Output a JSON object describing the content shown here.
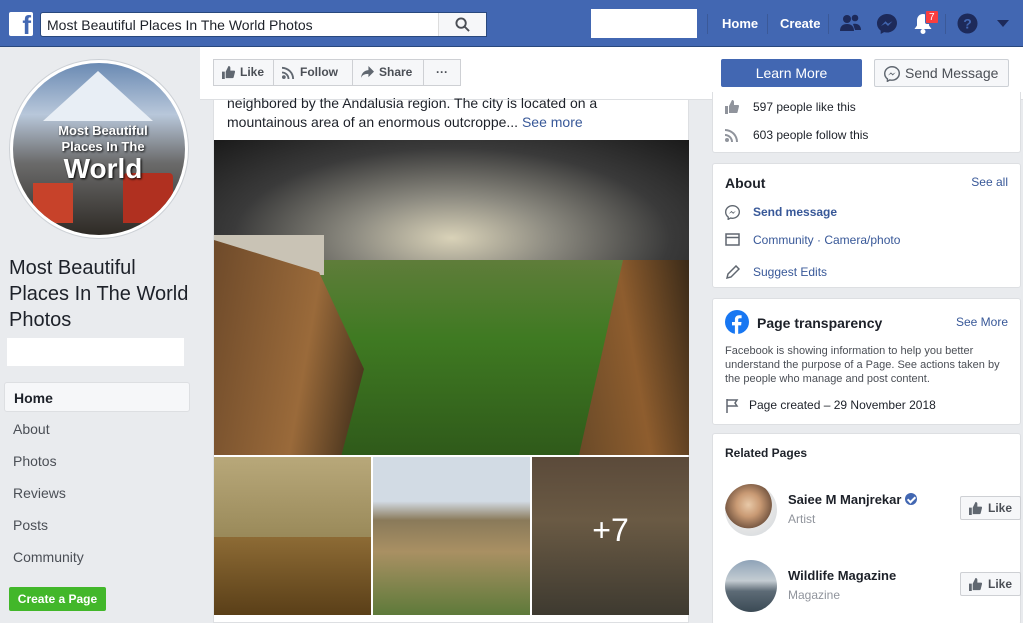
{
  "topbar": {
    "logo_glyph": "f",
    "search_query": "Most Beautiful Places In The World Photos",
    "nav_home": "Home",
    "nav_create": "Create",
    "notification_count": "7",
    "brand_color": "#4267b2"
  },
  "page": {
    "avatar": {
      "line1": "Most Beautiful",
      "line2": "Places In The",
      "line3": "World"
    },
    "name": "Most Beautiful Places In The World Photos"
  },
  "sidebar": {
    "items": [
      {
        "label": "Home",
        "active": true
      },
      {
        "label": "About"
      },
      {
        "label": "Photos"
      },
      {
        "label": "Reviews"
      },
      {
        "label": "Posts"
      },
      {
        "label": "Community"
      }
    ],
    "create_page": "Create a Page"
  },
  "actions": {
    "like": "Like",
    "follow": "Follow",
    "share": "Share",
    "more": "···",
    "learn_more": "Learn More",
    "send_message": "Send Message"
  },
  "post": {
    "text_line1": "neighbored by the Andalusia region. The city is located on a",
    "text_line2": "mountainous area of an enormous outcroppe...",
    "see_more": "See more",
    "extra_photos": "+7"
  },
  "stats": {
    "likes": "597 people like this",
    "follows": "603 people follow this"
  },
  "about": {
    "title": "About",
    "see_all": "See all",
    "send_message": "Send message",
    "category": "Community · Camera/photo",
    "suggest_edits": "Suggest Edits"
  },
  "transparency": {
    "title": "Page transparency",
    "see_more": "See More",
    "description": "Facebook is showing information to help you better understand the purpose of a Page. See actions taken by the people who manage and post content.",
    "created": "Page created – 29 November 2018"
  },
  "related": {
    "title": "Related Pages",
    "pages": [
      {
        "name": "Saiee M Manjrekar",
        "category": "Artist",
        "button": "Like",
        "verified": true
      },
      {
        "name": "Wildlife Magazine",
        "category": "Magazine",
        "button": "Like"
      }
    ]
  }
}
